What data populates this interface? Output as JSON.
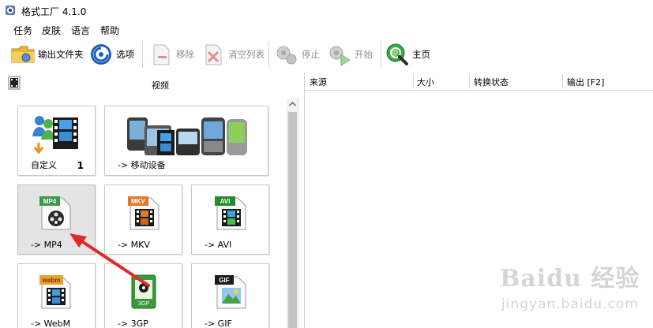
{
  "window": {
    "title": "格式工厂 4.1.0"
  },
  "menu": {
    "items": [
      "任务",
      "皮肤",
      "语言",
      "帮助"
    ]
  },
  "toolbar": {
    "output_folder": "输出文件夹",
    "options": "选项",
    "remove": "移除",
    "clear_list": "清空列表",
    "stop": "停止",
    "start": "开始",
    "home": "主页"
  },
  "left_panel": {
    "title": "视频",
    "tiles": {
      "custom": {
        "label": "自定义",
        "count": "1"
      },
      "mobile": {
        "label": "-> 移动设备"
      },
      "mp4": {
        "label": "-> MP4",
        "badge": "MP4"
      },
      "mkv": {
        "label": "-> MKV",
        "badge": "MKV"
      },
      "avi": {
        "label": "-> AVI",
        "badge": "AVI"
      },
      "webm": {
        "label": "-> WebM",
        "badge": "webm"
      },
      "3gp": {
        "label": "-> 3GP",
        "badge": "3GP"
      },
      "gif": {
        "label": "-> GIF",
        "badge": "GIF"
      }
    }
  },
  "task_list": {
    "columns": [
      "来源",
      "大小",
      "转换状态",
      "输出 [F2]"
    ],
    "rows": []
  },
  "watermark": {
    "brand": "Baidu 经验",
    "url": "jingyan.baidu.com"
  },
  "colors": {
    "accent_red": "#e02a2a",
    "film_dark": "#1b1b1b",
    "avi_green": "#2a8a2a",
    "mkv_orange": "#e07a2a"
  }
}
